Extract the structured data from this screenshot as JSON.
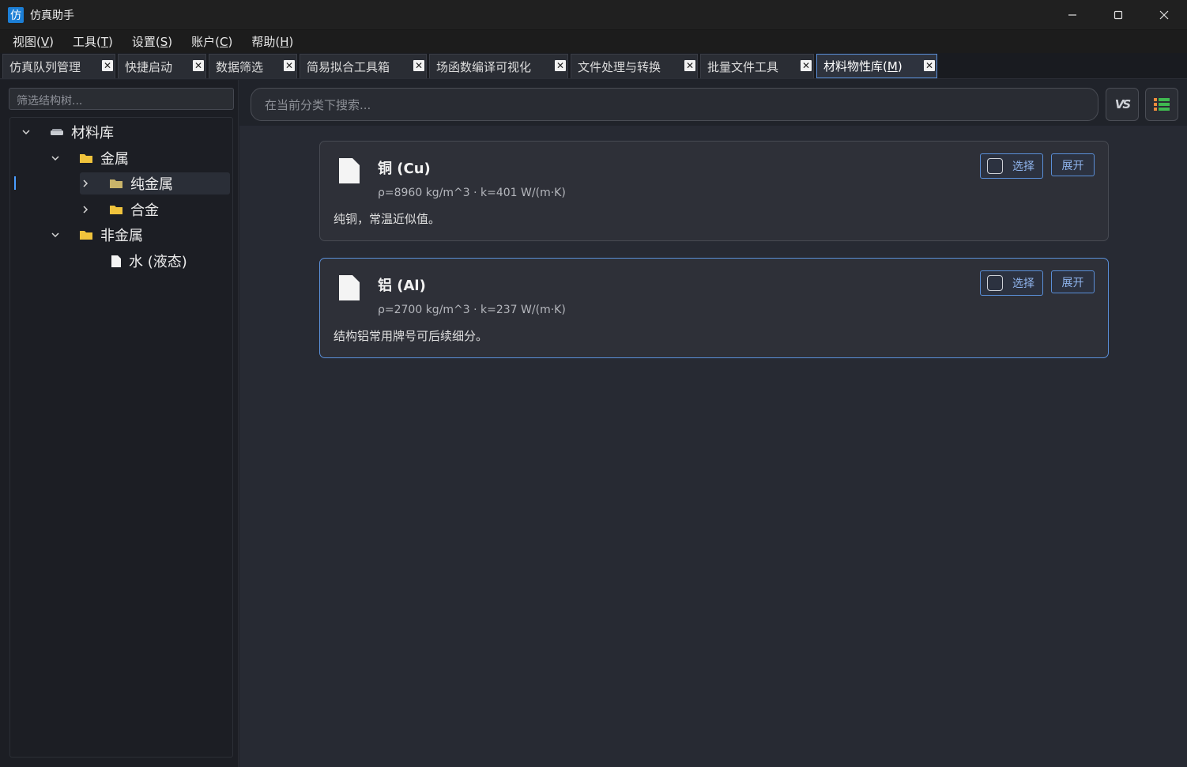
{
  "window": {
    "icon_char": "仿",
    "title": "仿真助手",
    "controls": {
      "minimize": "─",
      "maximize": "☐",
      "close": "✕"
    }
  },
  "menu": [
    {
      "label": "视图(",
      "key": "V",
      "end": ")"
    },
    {
      "label": "工具(",
      "key": "T",
      "end": ")"
    },
    {
      "label": "设置(",
      "key": "S",
      "end": ")"
    },
    {
      "label": "账户(",
      "key": "C",
      "end": ")"
    },
    {
      "label": "帮助(",
      "key": "H",
      "end": ")"
    }
  ],
  "tabs": [
    {
      "label": "仿真队列管理",
      "close": "✕"
    },
    {
      "label": "快捷启动",
      "close": "✕"
    },
    {
      "label": "数据筛选",
      "close": "✕"
    },
    {
      "label": "简易拟合工具箱",
      "close": "✕"
    },
    {
      "label": "场函数编译可视化",
      "close": "✕"
    },
    {
      "label": "文件处理与转换",
      "close": "✕"
    },
    {
      "label": "批量文件工具",
      "close": "✕"
    },
    {
      "label": "材料物性库(",
      "key": "M",
      "end": ")",
      "close": "✕"
    }
  ],
  "tree": {
    "filter_placeholder": "筛选结构树...",
    "nodes": [
      {
        "label": "材料库",
        "expanded": true
      },
      {
        "label": "金属",
        "expanded": true
      },
      {
        "label": "纯金属",
        "expanded": false,
        "selected": true
      },
      {
        "label": "合金",
        "expanded": false
      },
      {
        "label": "非金属",
        "expanded": true
      },
      {
        "label": "水 (液态)"
      }
    ]
  },
  "main": {
    "search_placeholder": "在当前分类下搜索...",
    "vs_button": "VS",
    "cards": [
      {
        "title": "铜 (Cu)",
        "props": "ρ=8960 kg/m^3 · k=401 W/(m·K)",
        "desc": "纯铜，常温近似值。",
        "select_label": "选择",
        "expand_label": "展开",
        "checked": false
      },
      {
        "title": "铝 (Al)",
        "props": "ρ=2700 kg/m^3 · k=237 W/(m·K)",
        "desc": "结构铝常用牌号可后续细分。",
        "select_label": "选择",
        "expand_label": "展开",
        "checked": false
      }
    ]
  },
  "colors": {
    "accent": "#5a8fd8",
    "folder": "#f0c33c",
    "list_icon": "#3fb950"
  }
}
